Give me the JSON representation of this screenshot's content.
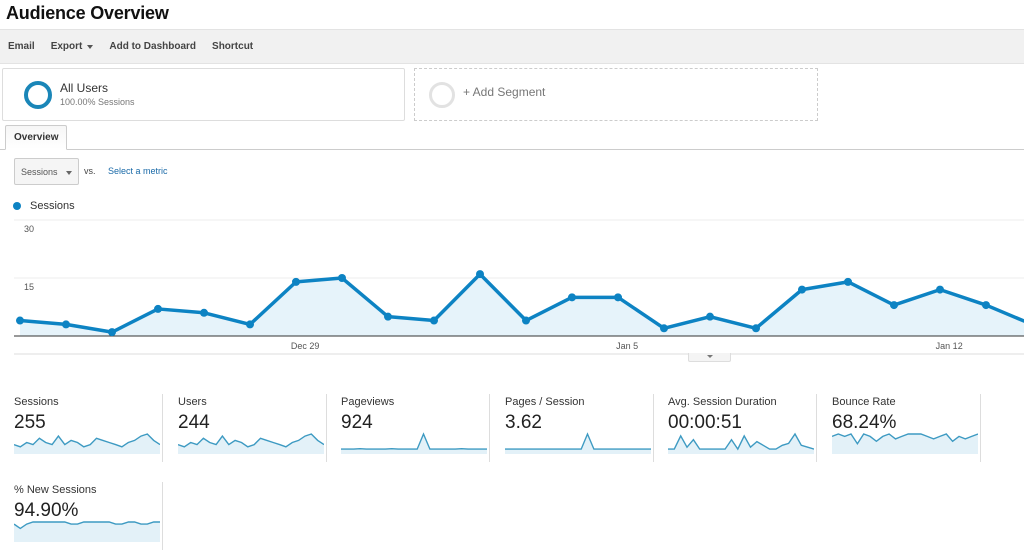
{
  "page": {
    "title": "Audience Overview"
  },
  "toolbar": {
    "items": [
      {
        "label": "Email"
      },
      {
        "label": "Export",
        "has_dropdown": true
      },
      {
        "label": "Add to Dashboard"
      },
      {
        "label": "Shortcut"
      }
    ]
  },
  "segments": {
    "active": {
      "name": "All Users",
      "sub": "100.00% Sessions",
      "color": "#1a86b8"
    },
    "add_label": "+ Add Segment"
  },
  "tabs": [
    {
      "label": "Overview",
      "active": true
    }
  ],
  "metric_picker": {
    "selected": "Sessions",
    "vs_label": "vs.",
    "select_metric_label": "Select a metric"
  },
  "colors": {
    "series": "#0d83c3",
    "area": "#e6f3fa",
    "grid": "#eeeeee",
    "axis": "#333333"
  },
  "chart_data": {
    "type": "area",
    "title": "",
    "legend": [
      {
        "name": "Sessions",
        "color": "#0d83c3"
      }
    ],
    "legend_position": "top-left",
    "xlabel": "",
    "ylabel": "",
    "ylim": [
      0,
      30
    ],
    "yticks": [
      15,
      30
    ],
    "grid": true,
    "x_tick_labels": [
      {
        "label": "Dec 29",
        "index": 6.2
      },
      {
        "label": "Jan 5",
        "index": 13.2
      },
      {
        "label": "Jan 12",
        "index": 20.2
      }
    ],
    "series": [
      {
        "name": "Sessions",
        "values": [
          4,
          3,
          1,
          7,
          6,
          3,
          14,
          15,
          5,
          4,
          16,
          4,
          10,
          10,
          2,
          5,
          2,
          12,
          14,
          8,
          12,
          8,
          3
        ]
      }
    ]
  },
  "scorecards": [
    {
      "label": "Sessions",
      "value": "255",
      "spark": [
        3,
        2,
        4,
        3,
        6,
        4,
        3,
        7,
        3,
        5,
        4,
        2,
        3,
        6,
        5,
        4,
        3,
        2,
        4,
        5,
        7,
        8,
        5,
        3
      ],
      "style": "normal"
    },
    {
      "label": "Users",
      "value": "244",
      "spark": [
        3,
        2,
        4,
        3,
        6,
        4,
        3,
        7,
        3,
        5,
        4,
        2,
        3,
        6,
        5,
        4,
        3,
        2,
        4,
        5,
        7,
        8,
        5,
        3
      ],
      "style": "normal"
    },
    {
      "label": "Pageviews",
      "value": "924",
      "spark": [
        1,
        1,
        1,
        1.2,
        1,
        1,
        1,
        1,
        1.2,
        1,
        1,
        1,
        1,
        9,
        1,
        1,
        1,
        1,
        1,
        1.2,
        1,
        1,
        1,
        1
      ],
      "style": "flat"
    },
    {
      "label": "Pages / Session",
      "value": "3.62",
      "spark": [
        1,
        1,
        1,
        1,
        1,
        1,
        1,
        1,
        1,
        1,
        1,
        1,
        1,
        9,
        1,
        1,
        1,
        1,
        1,
        1,
        1,
        1,
        1,
        1
      ],
      "style": "flat"
    },
    {
      "label": "Avg. Session Duration",
      "value": "00:00:51",
      "spark": [
        1,
        1,
        8,
        2,
        6,
        1,
        1,
        1,
        1,
        1,
        6,
        1,
        8,
        2,
        5,
        3,
        1,
        1,
        3,
        4,
        9,
        3,
        2,
        1
      ],
      "style": "spiky"
    },
    {
      "label": "Bounce Rate",
      "value": "68.24%",
      "spark": [
        6,
        7,
        6,
        7,
        3,
        7,
        6,
        4,
        6,
        7,
        5,
        6,
        7,
        7,
        7,
        6,
        5,
        6,
        7,
        4,
        6,
        5,
        6,
        7
      ],
      "style": "high"
    },
    {
      "label": "% New Sessions",
      "value": "94.90%",
      "spark": [
        7,
        5,
        7,
        8,
        8,
        8,
        8,
        8,
        8,
        7,
        7,
        8,
        8,
        8,
        8,
        8,
        7,
        7,
        8,
        8,
        7,
        7,
        8,
        8
      ],
      "style": "high"
    }
  ]
}
